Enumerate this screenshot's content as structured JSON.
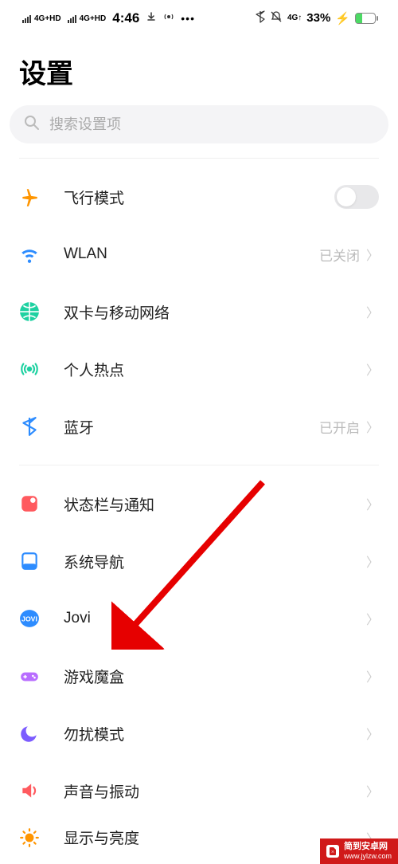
{
  "statusbar": {
    "signal1": "4G+HD",
    "signal2": "4G+HD",
    "time": "4:46",
    "net_right": "4G↑",
    "battery_pct": "33%"
  },
  "page": {
    "title": "设置"
  },
  "search": {
    "placeholder": "搜索设置项"
  },
  "rows": {
    "airplane": {
      "label": "飞行模式",
      "switch_on": false
    },
    "wlan": {
      "label": "WLAN",
      "value": "已关闭"
    },
    "dualsim": {
      "label": "双卡与移动网络"
    },
    "hotspot": {
      "label": "个人热点"
    },
    "bluetooth": {
      "label": "蓝牙",
      "value": "已开启"
    },
    "statusbar_notif": {
      "label": "状态栏与通知"
    },
    "sysnav": {
      "label": "系统导航"
    },
    "jovi": {
      "label": "Jovi"
    },
    "gamebox": {
      "label": "游戏魔盒"
    },
    "dnd": {
      "label": "勿扰模式"
    },
    "sound": {
      "label": "声音与振动"
    },
    "display": {
      "label": "显示与亮度"
    }
  },
  "icons": {
    "airplane_color": "#ff9500",
    "wifi_color": "#2d8cff",
    "globe_color": "#1dd1a1",
    "hotspot_color": "#1dd1a1",
    "bt_color": "#2d8cff",
    "notif_color": "#ff5a5f",
    "nav_color": "#2d8cff",
    "jovi_color": "#2d8cff",
    "game_color": "#b86dff",
    "dnd_color": "#7c5cff",
    "sound_color": "#ff5a5f",
    "display_color": "#ff9500"
  },
  "watermark": {
    "line1": "简到安卓网",
    "line2": "www.jylzw.com"
  }
}
